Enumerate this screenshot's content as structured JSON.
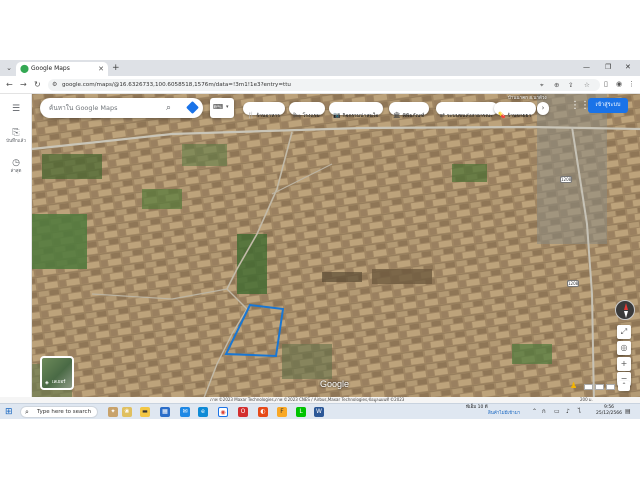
{
  "browser": {
    "tab_title": "Google Maps",
    "url": "google.com/maps/@16.6326733,100.6058518,1576m/data=!3m1!1e3?entry=ttu",
    "new_tab": "+",
    "minimize": "—",
    "restore": "❐",
    "close": "✕"
  },
  "rail": {
    "menu_label": "",
    "saved_label": "บันทึกแล้ว",
    "recent_label": "ล่าสุด"
  },
  "maps": {
    "search_placeholder": "ค้นหาใน Google Maps",
    "chips": [
      {
        "icon": "🍴",
        "label": "ร้านอาหาร"
      },
      {
        "icon": "🛏",
        "label": "โรงแรม"
      },
      {
        "icon": "📷",
        "label": "กิจกรรมน่าสนใจ"
      },
      {
        "icon": "🏛",
        "label": "พิพิธภัณฑ์"
      },
      {
        "icon": "⇄",
        "label": "ระบบขนส่งสาธารณะ"
      },
      {
        "icon": "💊",
        "label": "ร้านขายยา"
      }
    ],
    "signin_label": "เข้าสู่ระบบ",
    "layers_label": "เลเยอร์",
    "logo": "Google",
    "road_shield_1": "1208",
    "road_shield_2": "1208",
    "place_label_top": "บ้านนาคก อ.นาด้วง",
    "attribution": "ภาพ ©2023 Maxar Technologies,ภาพ ©2023 CNES / Airbus,Maxar Technologies,ข้อมูลแผนที่ ©2023",
    "scale": "200 ม."
  },
  "taskbar": {
    "search_text": "Type here to search",
    "weather": "พีเอ็ม 10 ดี",
    "weather_sub": "สินค้าไม่มีเข้ามา",
    "time": "9:56",
    "date": "25/12/2566",
    "colors": {
      "accent": "#1a73e8",
      "taskbar": "#dfe7f1"
    }
  }
}
